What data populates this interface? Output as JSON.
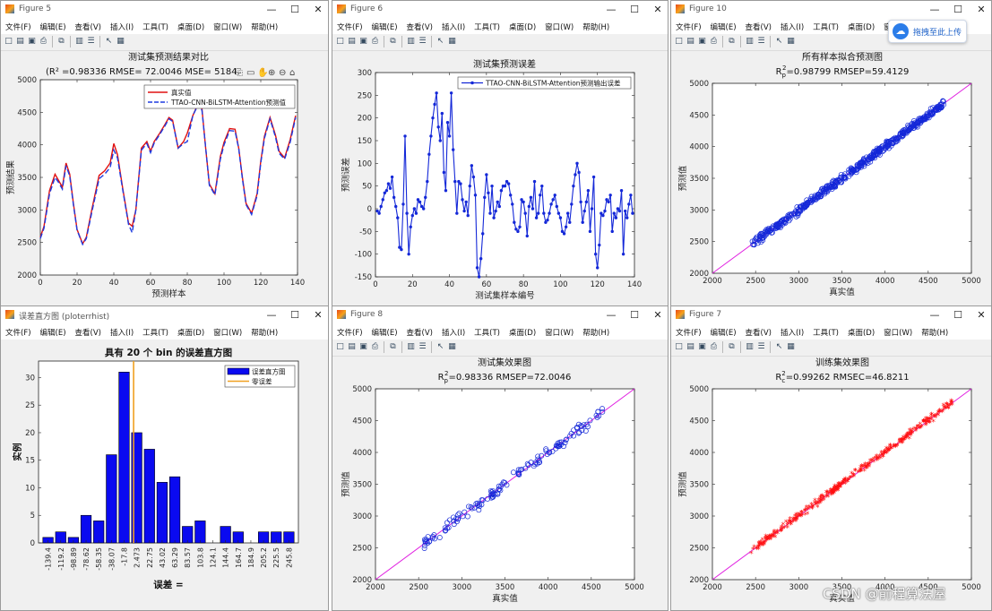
{
  "menu": [
    "文件(F)",
    "编辑(E)",
    "查看(V)",
    "插入(I)",
    "工具(T)",
    "桌面(D)",
    "窗口(W)",
    "帮助(H)"
  ],
  "windows": {
    "fig5": {
      "title": "Figure 5"
    },
    "fig6": {
      "title": "Figure 6"
    },
    "fig10": {
      "title": "Figure 10"
    },
    "hist": {
      "title": "误差直方图 (ploterrhist)"
    },
    "fig8": {
      "title": "Figure 8"
    },
    "fig7": {
      "title": "Figure 7"
    }
  },
  "overlay": {
    "upload_label": "拖拽至此上传",
    "watermark": "CSDN @前程算法屋"
  },
  "chart_data": [
    {
      "id": "fig5",
      "type": "line",
      "title": "测试集预测结果对比",
      "subtitle": "(R² =0.98336 RMSE= 72.0046 MSE= 5184.",
      "xlabel": "预测样本",
      "ylabel": "预测结果",
      "xlim": [
        0,
        140
      ],
      "ylim": [
        2000,
        5000
      ],
      "xticks": [
        0,
        20,
        40,
        60,
        80,
        100,
        120,
        140
      ],
      "yticks": [
        2000,
        2500,
        3000,
        3500,
        4000,
        4500,
        5000
      ],
      "legend": [
        "真实值",
        "TTAO-CNN-BiLSTM-Attention预测值"
      ],
      "legend_position": "top-right",
      "series": [
        {
          "name": "真实值",
          "color": "#e01010",
          "x": [
            0,
            2,
            5,
            8,
            10,
            12,
            14,
            16,
            18,
            20,
            23,
            25,
            28,
            32,
            35,
            38,
            40,
            42,
            45,
            48,
            50,
            52,
            55,
            58,
            60,
            62,
            65,
            68,
            70,
            72,
            75,
            78,
            80,
            83,
            86,
            88,
            90,
            92,
            95,
            98,
            100,
            103,
            106,
            108,
            110,
            112,
            115,
            118,
            120,
            122,
            125,
            128,
            130,
            133,
            136,
            139
          ],
          "y": [
            2580,
            2750,
            3300,
            3550,
            3450,
            3350,
            3720,
            3550,
            3100,
            2700,
            2480,
            2580,
            3000,
            3530,
            3600,
            3720,
            4020,
            3850,
            3300,
            2800,
            2750,
            3000,
            3950,
            4050,
            3900,
            4050,
            4180,
            4320,
            4420,
            4380,
            3950,
            4050,
            4180,
            4450,
            4640,
            4550,
            3950,
            3400,
            3250,
            3820,
            4040,
            4250,
            4240,
            3950,
            3500,
            3100,
            2950,
            3250,
            3750,
            4130,
            4420,
            4150,
            3900,
            3800,
            4080,
            4450
          ]
        },
        {
          "name": "TTAO-CNN-BiLSTM-Attention预测值",
          "color": "#1e3be0",
          "dash": true,
          "x": [
            0,
            2,
            5,
            8,
            10,
            12,
            14,
            16,
            18,
            20,
            23,
            25,
            28,
            32,
            35,
            38,
            40,
            42,
            45,
            48,
            50,
            52,
            55,
            58,
            60,
            62,
            65,
            68,
            70,
            72,
            75,
            78,
            80,
            83,
            86,
            88,
            90,
            92,
            95,
            98,
            100,
            103,
            106,
            108,
            110,
            112,
            115,
            118,
            120,
            122,
            125,
            128,
            130,
            133,
            136,
            139
          ],
          "y": [
            2560,
            2720,
            3250,
            3500,
            3420,
            3320,
            3680,
            3520,
            3080,
            2690,
            2470,
            2560,
            2960,
            3480,
            3550,
            3650,
            3920,
            3800,
            3280,
            2780,
            2650,
            3000,
            3920,
            4020,
            3880,
            4030,
            4160,
            4300,
            4400,
            4360,
            3950,
            4020,
            4050,
            4450,
            4620,
            4530,
            3960,
            3380,
            3230,
            3780,
            4000,
            4220,
            4210,
            3940,
            3480,
            3080,
            2930,
            3220,
            3720,
            4100,
            4400,
            4120,
            3870,
            3780,
            4040,
            4420
          ]
        }
      ]
    },
    {
      "id": "fig6",
      "type": "line",
      "title": "测试集预测误差",
      "xlabel": "测试集样本编号",
      "ylabel": "预测误差",
      "xlim": [
        0,
        140
      ],
      "ylim": [
        -150,
        300
      ],
      "xticks": [
        0,
        20,
        40,
        60,
        80,
        100,
        120,
        140
      ],
      "yticks": [
        -150,
        -100,
        -50,
        0,
        50,
        100,
        150,
        200,
        250,
        300
      ],
      "legend": [
        "TTAO-CNN-BiLSTM-Attention预测输出误差"
      ],
      "legend_position": "top-right",
      "series": [
        {
          "name": "TTAO-CNN-BiLSTM-Attention预测输出误差",
          "color": "#1428d8",
          "x": [
            1,
            2,
            3,
            4,
            5,
            6,
            7,
            8,
            9,
            10,
            11,
            12,
            13,
            14,
            15,
            16,
            17,
            18,
            19,
            20,
            21,
            22,
            23,
            24,
            25,
            26,
            27,
            28,
            29,
            30,
            31,
            32,
            33,
            34,
            35,
            36,
            37,
            38,
            39,
            40,
            41,
            42,
            43,
            44,
            45,
            46,
            47,
            48,
            49,
            50,
            51,
            52,
            53,
            54,
            55,
            56,
            57,
            58,
            59,
            60,
            61,
            62,
            63,
            64,
            65,
            66,
            67,
            68,
            69,
            70,
            71,
            72,
            73,
            74,
            75,
            76,
            77,
            78,
            79,
            80,
            81,
            82,
            83,
            84,
            85,
            86,
            87,
            88,
            89,
            90,
            91,
            92,
            93,
            94,
            95,
            96,
            97,
            98,
            99,
            100,
            101,
            102,
            103,
            104,
            105,
            106,
            107,
            108,
            109,
            110,
            111,
            112,
            113,
            114,
            115,
            116,
            117,
            118,
            119,
            120,
            121,
            122,
            123,
            124,
            125,
            126,
            127,
            128,
            129,
            130,
            131,
            132,
            133,
            134,
            135,
            136,
            137,
            138,
            139
          ],
          "y": [
            -5,
            -10,
            5,
            20,
            35,
            40,
            55,
            45,
            70,
            25,
            5,
            -20,
            -85,
            -90,
            10,
            160,
            -10,
            -100,
            -40,
            -15,
            0,
            -10,
            20,
            15,
            5,
            0,
            25,
            60,
            120,
            160,
            200,
            230,
            255,
            180,
            150,
            210,
            80,
            40,
            190,
            160,
            255,
            130,
            60,
            -10,
            60,
            55,
            20,
            -5,
            15,
            -15,
            50,
            95,
            70,
            30,
            -130,
            -150,
            -110,
            -55,
            25,
            75,
            35,
            -10,
            50,
            -20,
            -5,
            15,
            5,
            40,
            50,
            50,
            60,
            55,
            30,
            10,
            -30,
            -45,
            -50,
            -40,
            20,
            15,
            -10,
            -60,
            5,
            25,
            0,
            60,
            -20,
            -10,
            30,
            50,
            -10,
            -30,
            -25,
            -10,
            10,
            20,
            30,
            5,
            -10,
            -20,
            -50,
            -55,
            -40,
            -10,
            -30,
            10,
            50,
            75,
            100,
            80,
            15,
            -30,
            -5,
            15,
            40,
            -50,
            0,
            70,
            -100,
            -130,
            -80,
            -10,
            -15,
            -5,
            20,
            15,
            30,
            -50,
            -10,
            -20,
            0,
            -5,
            40,
            -100,
            -5,
            -20,
            10,
            30,
            -10
          ]
        }
      ]
    },
    {
      "id": "fig10",
      "type": "scatter",
      "title": "所有样本拟合预测图",
      "subtitle_parts": [
        "R",
        "p",
        "2",
        "=0.98799  RMSEP=59.4129"
      ],
      "xlabel": "真实值",
      "ylabel": "预测值",
      "xlim": [
        2000,
        5000
      ],
      "ylim": [
        2000,
        5000
      ],
      "xticks": [
        2000,
        2500,
        3000,
        3500,
        4000,
        4500,
        5000
      ],
      "yticks": [
        2000,
        2500,
        3000,
        3500,
        4000,
        4500,
        5000
      ],
      "marker": "o",
      "color": "#1428d8",
      "n_points": 520,
      "spread": 45,
      "range": [
        2440,
        4680
      ],
      "reference_line": [
        [
          2000,
          2000
        ],
        [
          5000,
          5000
        ]
      ]
    },
    {
      "id": "hist",
      "type": "bar",
      "title": "具有 20 个 bin 的误差直方图",
      "xlabel": "误差 =",
      "ylabel": "实例",
      "ylim": [
        0,
        33
      ],
      "yticks": [
        0,
        5,
        10,
        15,
        20,
        25,
        30
      ],
      "categories": [
        "-139.4",
        "-119.2",
        "-98.89",
        "-78.62",
        "-58.35",
        "-38.07",
        "-17.8",
        "2.473",
        "22.75",
        "43.02",
        "63.29",
        "83.57",
        "103.8",
        "124.1",
        "144.4",
        "164.7",
        "184.9",
        "205.2",
        "225.5",
        "245.8"
      ],
      "values": [
        1,
        2,
        1,
        5,
        4,
        16,
        31,
        20,
        17,
        11,
        12,
        3,
        4,
        0,
        3,
        2,
        0,
        2,
        2,
        2
      ],
      "zero_error_index": 6.75,
      "legend": [
        "误差直方图",
        "零误差"
      ],
      "legend_position": "top-right",
      "colors": {
        "bars": "#0a0af0",
        "zero_error": "#f0a020"
      }
    },
    {
      "id": "fig8",
      "type": "scatter",
      "title": "测试集效果图",
      "subtitle_parts": [
        "R",
        "p",
        "2",
        "=0.98336  RMSEP=72.0046"
      ],
      "xlabel": "真实值",
      "ylabel": "预测值",
      "xlim": [
        2000,
        5000
      ],
      "ylim": [
        2000,
        5000
      ],
      "xticks": [
        2000,
        2500,
        3000,
        3500,
        4000,
        4500,
        5000
      ],
      "yticks": [
        2000,
        2500,
        3000,
        3500,
        4000,
        4500,
        5000
      ],
      "marker": "o",
      "color": "#1428d8",
      "n_points": 140,
      "spread": 55,
      "range": [
        2480,
        4640
      ],
      "reference_line": [
        [
          2000,
          2000
        ],
        [
          5000,
          5000
        ]
      ]
    },
    {
      "id": "fig7",
      "type": "scatter",
      "title": "训练集效果图",
      "subtitle_parts": [
        "R",
        "c",
        "2",
        "=0.99262  RMSEC=46.8211"
      ],
      "xlabel": "真实值",
      "ylabel": "预测值",
      "xlim": [
        2000,
        5000
      ],
      "ylim": [
        2000,
        5000
      ],
      "xticks": [
        2000,
        2500,
        3000,
        3500,
        4000,
        4500,
        5000
      ],
      "yticks": [
        2000,
        2500,
        3000,
        3500,
        4000,
        4500,
        5000
      ],
      "marker": "*",
      "color": "#ff1010",
      "n_points": 380,
      "spread": 40,
      "range": [
        2440,
        4780
      ],
      "reference_line": [
        [
          2000,
          2000
        ],
        [
          5000,
          5000
        ]
      ]
    }
  ]
}
